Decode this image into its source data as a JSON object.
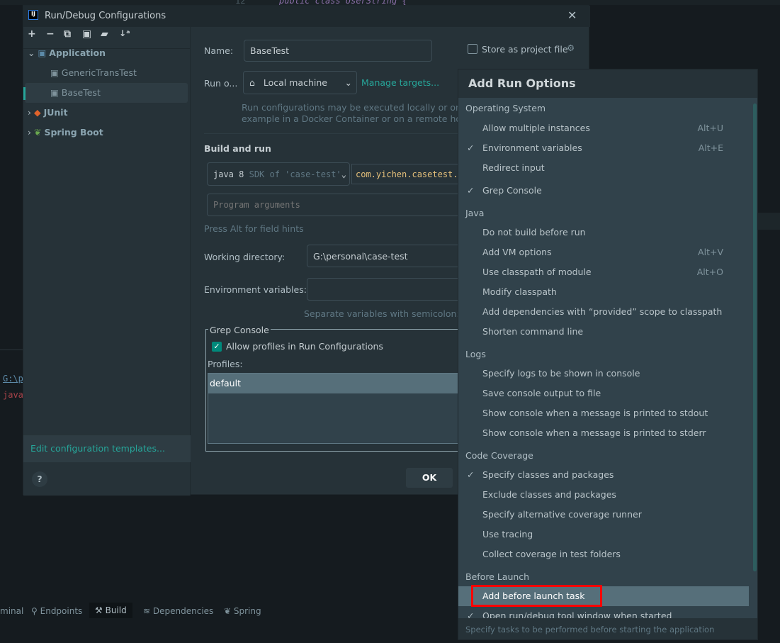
{
  "background": {
    "editor_line_number": "12",
    "editor_code": "public class UserString {",
    "console_path": "G:\\p",
    "console_error": "java",
    "tool_tabs": [
      {
        "label": "minal",
        "icon": "terminal-icon"
      },
      {
        "label": "Endpoints",
        "icon": "endpoints-icon"
      },
      {
        "label": "Build",
        "icon": "hammer-icon"
      },
      {
        "label": "Dependencies",
        "icon": "layers-icon"
      },
      {
        "label": "Spring",
        "icon": "spring-leaf-icon"
      }
    ]
  },
  "dialog": {
    "title": "Run/Debug Configurations",
    "toolbar": [
      "add-icon",
      "remove-icon",
      "copy-icon",
      "save-icon",
      "new-folder-icon",
      "sort-icon"
    ],
    "tree": {
      "application": "Application",
      "children": [
        "GenericTransTest",
        "BaseTest"
      ],
      "selected": "BaseTest",
      "junit": "JUnit",
      "spring_boot": "Spring Boot"
    },
    "edit_templates": "Edit configuration templates...",
    "help": "?",
    "ok": "OK",
    "form": {
      "name_label": "Name:",
      "name_value": "BaseTest",
      "store_label": "Store as project file",
      "store_checked": false,
      "run_on_label": "Run o...",
      "run_on_value": "Local machine",
      "manage_targets": "Manage targets...",
      "run_on_hint_1": "Run configurations may be executed locally or on a t",
      "run_on_hint_2": "example in a Docker Container or on a remote host",
      "build_and_run": "Build and run",
      "jdk_main": "java 8",
      "jdk_sub": "SDK of 'case-test'",
      "main_class": "com.yichen.casetest.t",
      "program_args_placeholder": "Program arguments",
      "alt_hint": "Press Alt for field hints",
      "working_dir_label": "Working directory:",
      "working_dir_value": "G:\\personal\\case-test",
      "env_label": "Environment variables:",
      "env_value": "",
      "env_hint": "Separate variables with semicolon: VA",
      "grep_title": "Grep Console",
      "allow_profiles": "Allow profiles in Run Configurations",
      "allow_profiles_checked": true,
      "profiles_label": "Profiles:",
      "profiles": [
        "default"
      ]
    }
  },
  "popup": {
    "title": "Add Run Options",
    "rows": [
      {
        "type": "category",
        "label": "Operating System"
      },
      {
        "type": "item",
        "label": "Allow multiple instances",
        "shortcut": "Alt+U",
        "checked": false
      },
      {
        "type": "item",
        "label": "Environment variables",
        "shortcut": "Alt+E",
        "checked": true
      },
      {
        "type": "item",
        "label": "Redirect input",
        "shortcut": "",
        "checked": false
      },
      {
        "type": "item",
        "label": "Grep Console",
        "shortcut": "",
        "checked": true
      },
      {
        "type": "category",
        "label": "Java"
      },
      {
        "type": "item",
        "label": "Do not build before run",
        "shortcut": "",
        "checked": false
      },
      {
        "type": "item",
        "label": "Add VM options",
        "shortcut": "Alt+V",
        "checked": false
      },
      {
        "type": "item",
        "label": "Use classpath of module",
        "shortcut": "Alt+O",
        "checked": false
      },
      {
        "type": "item",
        "label": "Modify classpath",
        "shortcut": "",
        "checked": false
      },
      {
        "type": "item",
        "label": "Add dependencies with “provided” scope to classpath",
        "shortcut": "",
        "checked": false
      },
      {
        "type": "item",
        "label": "Shorten command line",
        "shortcut": "",
        "checked": false
      },
      {
        "type": "category",
        "label": "Logs"
      },
      {
        "type": "item",
        "label": "Specify logs to be shown in console",
        "shortcut": "",
        "checked": false
      },
      {
        "type": "item",
        "label": "Save console output to file",
        "shortcut": "",
        "checked": false
      },
      {
        "type": "item",
        "label": "Show console when a message is printed to stdout",
        "shortcut": "",
        "checked": false
      },
      {
        "type": "item",
        "label": "Show console when a message is printed to stderr",
        "shortcut": "",
        "checked": false
      },
      {
        "type": "category",
        "label": "Code Coverage"
      },
      {
        "type": "item",
        "label": "Specify classes and packages",
        "shortcut": "",
        "checked": true
      },
      {
        "type": "item",
        "label": "Exclude classes and packages",
        "shortcut": "",
        "checked": false
      },
      {
        "type": "item",
        "label": "Specify alternative coverage runner",
        "shortcut": "",
        "checked": false
      },
      {
        "type": "item",
        "label": "Use tracing",
        "shortcut": "",
        "checked": false
      },
      {
        "type": "item",
        "label": "Collect coverage in test folders",
        "shortcut": "",
        "checked": false
      },
      {
        "type": "category",
        "label": "Before Launch"
      },
      {
        "type": "item",
        "label": "Add before launch task",
        "shortcut": "",
        "checked": false,
        "selected": true,
        "annotated": true
      },
      {
        "type": "item",
        "label": "Open run/debug tool window when started",
        "shortcut": "",
        "checked": true
      }
    ],
    "footer": "Specify tasks to be performed before starting the application",
    "accent": "#26a69a",
    "annotation_color": "#ff0000"
  }
}
